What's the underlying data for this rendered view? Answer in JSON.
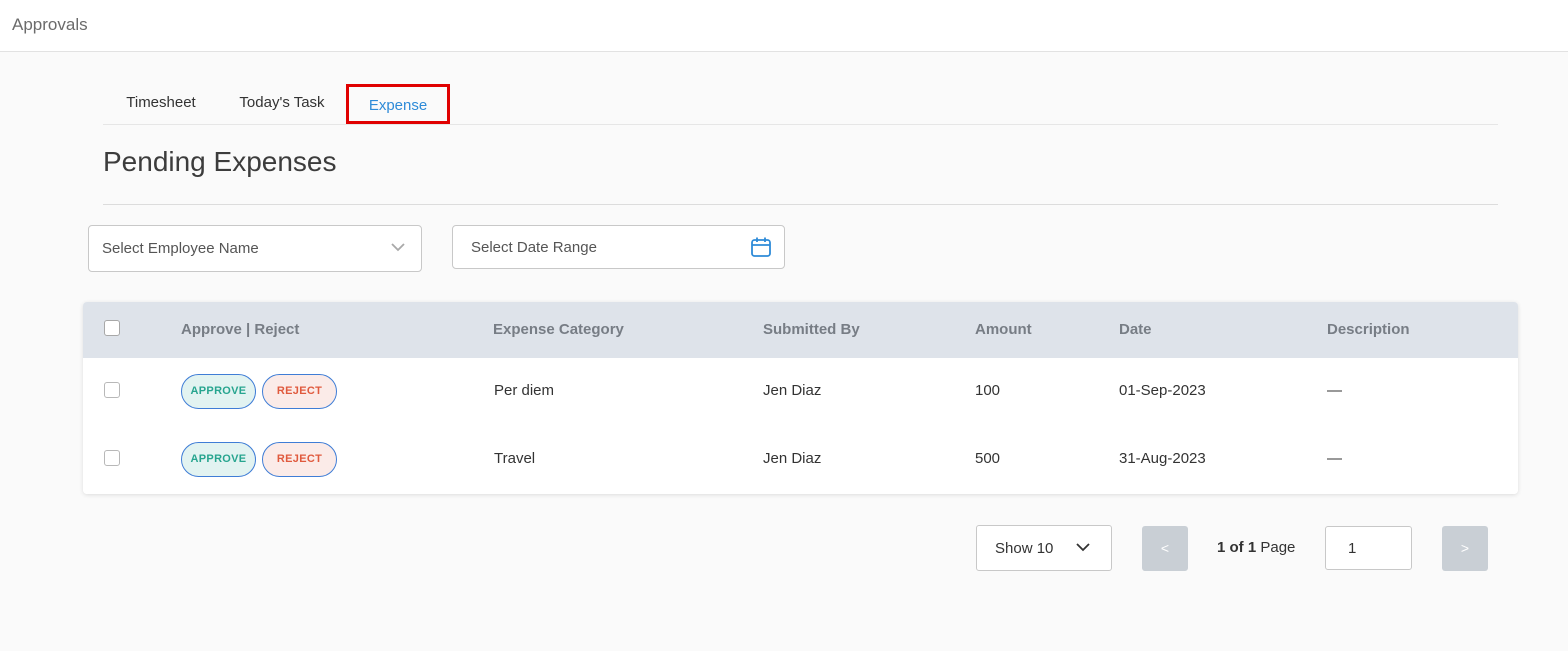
{
  "header": {
    "title": "Approvals"
  },
  "tabs": [
    {
      "label": "Timesheet"
    },
    {
      "label": "Today's Task"
    },
    {
      "label": "Expense",
      "active": true
    }
  ],
  "page": {
    "title": "Pending Expenses"
  },
  "filters": {
    "employee_placeholder": "Select Employee Name",
    "date_range_placeholder": "Select Date Range"
  },
  "table": {
    "columns": {
      "actions": "Approve | Reject",
      "category": "Expense Category",
      "submitted_by": "Submitted By",
      "amount": "Amount",
      "date": "Date",
      "description": "Description"
    },
    "approve_label": "APPROVE",
    "reject_label": "REJECT",
    "rows": [
      {
        "category": "Per diem",
        "submitted_by": "Jen Diaz",
        "amount": "100",
        "date": "01-Sep-2023",
        "description": "—"
      },
      {
        "category": "Travel",
        "submitted_by": "Jen Diaz",
        "amount": "500",
        "date": "31-Aug-2023",
        "description": "—"
      }
    ]
  },
  "pagination": {
    "show_label": "Show 10",
    "prev_label": "<",
    "next_label": ">",
    "current_of_total": "1 of 1",
    "page_word": "Page",
    "page_input_value": "1"
  },
  "colors": {
    "active_tab": "#2e8bd8",
    "highlight_border": "#e00000",
    "approve_text": "#27a58f",
    "reject_text": "#e05a3e",
    "table_header_bg": "#dee3ea"
  },
  "icons": {
    "employee_dropdown": "chevron-down-icon",
    "date_range": "calendar-icon",
    "show_dropdown": "chevron-down-icon"
  }
}
